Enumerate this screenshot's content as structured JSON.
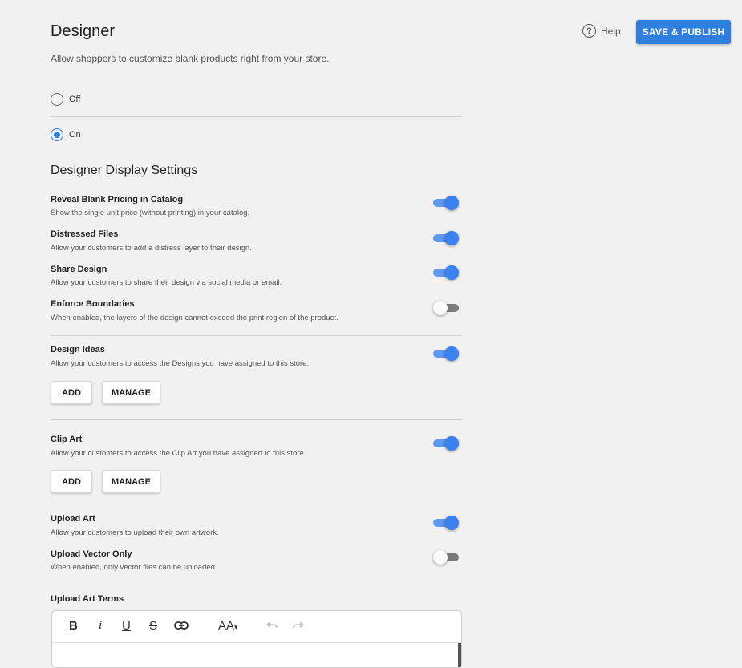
{
  "header": {
    "title": "Designer",
    "subtitle": "Allow shoppers to customize blank products right from your store.",
    "help_label": "Help",
    "help_icon_glyph": "?",
    "publish_label": "SAVE & PUBLISH"
  },
  "mode": {
    "off_label": "Off",
    "on_label": "On",
    "selected": "On"
  },
  "display_settings": {
    "heading": "Designer Display Settings",
    "reveal_pricing": {
      "title": "Reveal Blank Pricing in Catalog",
      "desc": "Show the single unit price (without printing) in your catalog.",
      "enabled": true
    },
    "distressed": {
      "title": "Distressed Files",
      "desc": "Allow your customers to add a distress layer to their design.",
      "enabled": true
    },
    "share": {
      "title": "Share Design",
      "desc": "Allow your customers to share their design via social media or email.",
      "enabled": true
    },
    "boundaries": {
      "title": "Enforce Boundaries",
      "desc": "When enabled, the layers of the design cannot exceed the print region of the product.",
      "enabled": false
    }
  },
  "design_ideas": {
    "title": "Design Ideas",
    "desc": "Allow your customers to access the Designs you have assigned to this store.",
    "enabled": true,
    "add_label": "ADD",
    "manage_label": "MANAGE"
  },
  "clip_art": {
    "title": "Clip Art",
    "desc": "Allow your customers to access the Clip Art you have assigned to this store.",
    "enabled": true,
    "add_label": "ADD",
    "manage_label": "MANAGE"
  },
  "upload_art": {
    "title": "Upload Art",
    "desc": "Allow your customers to upload their own artwork.",
    "enabled": true
  },
  "upload_vector": {
    "title": "Upload Vector Only",
    "desc": "When enabled, only vector files can be uploaded.",
    "enabled": false
  },
  "terms": {
    "heading": "Upload Art Terms",
    "toolbar": {
      "bold": "B",
      "italic": "i",
      "underline": "U",
      "strike": "S",
      "font_size": "AA",
      "font_caret": "▾"
    }
  },
  "colors": {
    "accent": "#2f7fe0",
    "toggle_on": "#3b82f0",
    "background": "#f1f1f1"
  }
}
